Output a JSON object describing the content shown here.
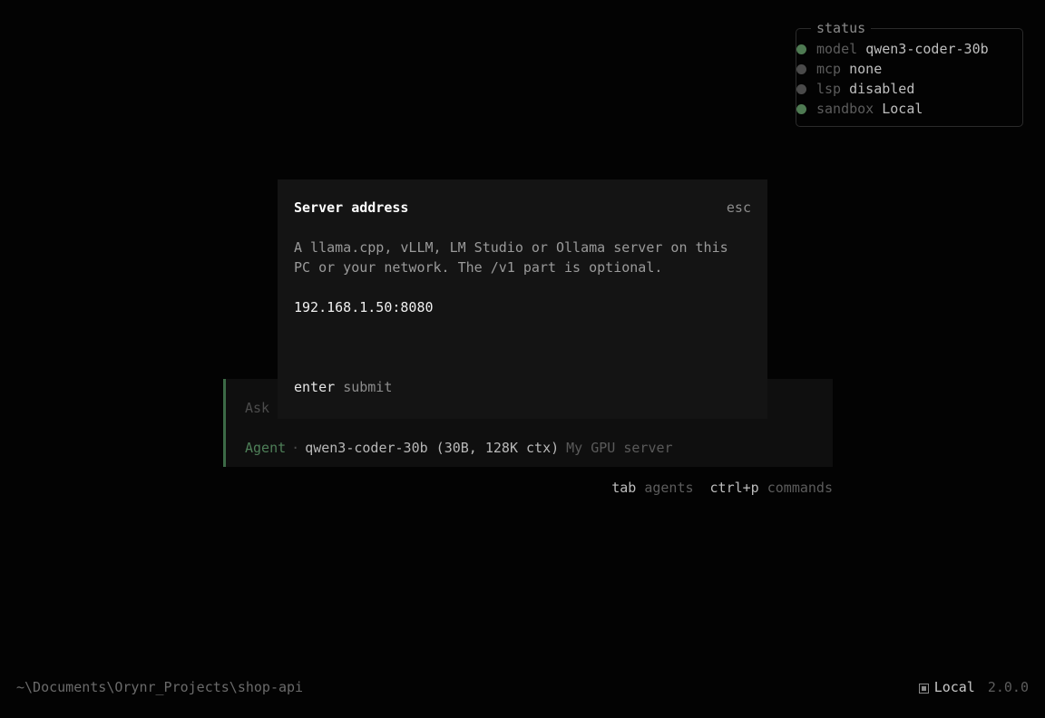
{
  "status": {
    "title": "status",
    "rows": [
      {
        "key": "model",
        "value": "qwen3-coder-30b",
        "state": "green"
      },
      {
        "key": "mcp",
        "value": "none",
        "state": "gray"
      },
      {
        "key": "lsp",
        "value": "disabled",
        "state": "gray"
      },
      {
        "key": "sandbox",
        "value": "Local",
        "state": "green"
      }
    ]
  },
  "prompt": {
    "placeholder": "Ask",
    "agent_label": "Agent",
    "separator": "·",
    "model": "qwen3-coder-30b (30B, 128K ctx)",
    "provider": "My GPU server"
  },
  "hints": {
    "tab_key": "tab",
    "tab_desc": "agents",
    "commands_key": "ctrl+p",
    "commands_desc": "commands"
  },
  "modal": {
    "title": "Server address",
    "esc_label": "esc",
    "description": "A llama.cpp, vLLM, LM Studio or Ollama server on this PC or your network. The /v1 part is optional.",
    "input_value": "192.168.1.50:8080",
    "footer_key": "enter",
    "footer_desc": "submit"
  },
  "footer": {
    "cwd": "~\\Documents\\Orynr_Projects\\shop-api",
    "environment": "Local",
    "version": "2.0.0"
  },
  "colors": {
    "accent_green": "#4e7a52",
    "background": "#030303",
    "modal_bg": "#141414"
  }
}
